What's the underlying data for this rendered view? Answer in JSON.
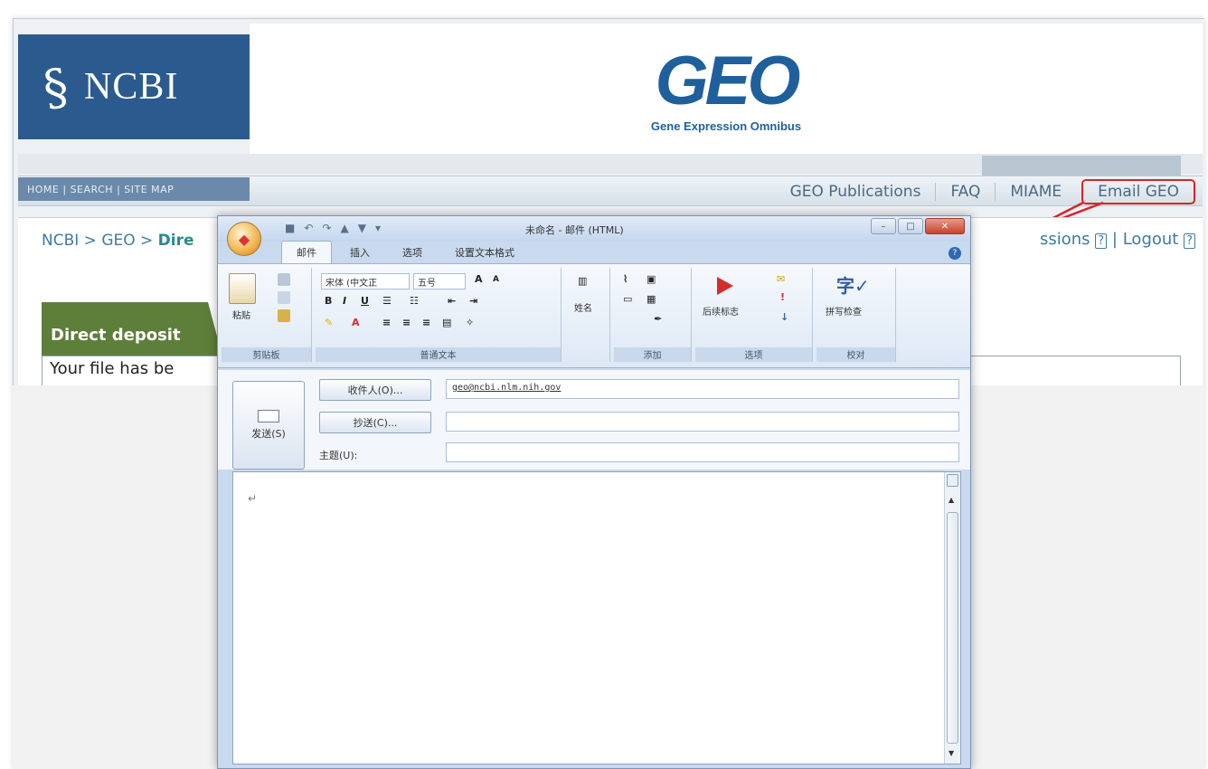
{
  "site": {
    "ncbi_logo_text": "NCBI",
    "geo_logo_text": "GEO",
    "geo_subtitle": "Gene Expression Omnibus",
    "nav_left": "HOME | SEARCH | SITE MAP",
    "top_links": [
      "GEO Publications",
      "FAQ",
      "MIAME",
      "Email GEO"
    ],
    "breadcrumb_prefix": "NCBI > GEO > ",
    "breadcrumb_current": "Dire",
    "right_links_text": "ssions",
    "logout_label": "Logout",
    "help_glyph": "?",
    "direct_deposit_title": "Direct deposit",
    "status_text": "Your file has be"
  },
  "mail": {
    "window_title": "未命名 - 邮件 (HTML)",
    "tabs": [
      "邮件",
      "插入",
      "选项",
      "设置文本格式"
    ],
    "active_tab": "邮件",
    "ribbon": {
      "paste_label": "粘贴",
      "clipboard_label": "剪贴板",
      "font_name": "宋体 (中文正",
      "font_size": "五号",
      "basic_text_label": "普通文本",
      "names_label": "姓名",
      "include_label": "添加",
      "followup_label": "后续标志",
      "options_label": "选项",
      "spelling_label": "拼写检查",
      "proofing_label": "校对"
    },
    "send_label": "发送(S)",
    "to_button": "收件人(O)...",
    "cc_button": "抄送(C)...",
    "subject_label": "主题(U):",
    "to_value": "geo@ncbi.nlm.nih.gov",
    "cc_value": "",
    "subject_value": "",
    "body_text": "↵"
  },
  "colors": {
    "ncbi_blue": "#2b5b8e",
    "geo_blue": "#1f5f9c",
    "highlight_red": "#d6262b",
    "deposit_green": "#5d7f3a"
  }
}
